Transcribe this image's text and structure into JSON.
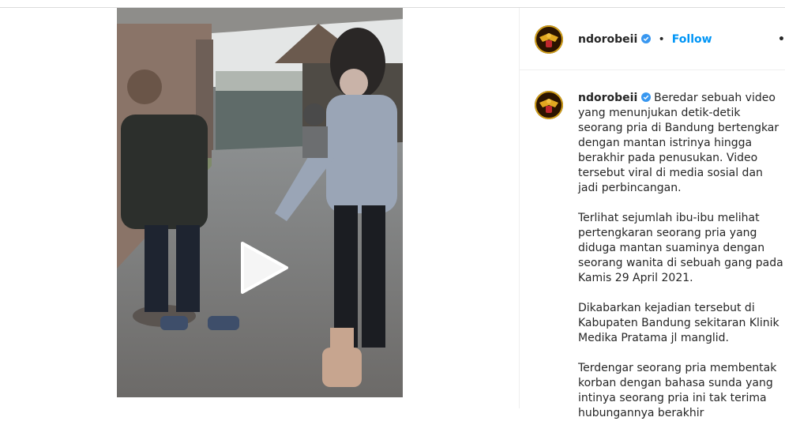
{
  "post": {
    "username": "ndorobeii",
    "follow_label": "Follow",
    "separator": "•",
    "more_glyph": "•"
  },
  "caption": {
    "username": "ndorobeii",
    "paragraphs": [
      "Beredar sebuah video yang menunjukan detik-detik seorang pria di Bandung bertengkar dengan mantan istrinya hingga berakhir pada penusukan. Video tersebut viral di media sosial dan jadi perbincangan.",
      "Terlihat sejumlah ibu-ibu melihat pertengkaran seorang pria yang diduga mantan suaminya dengan seorang wanita di sebuah gang pada Kamis 29 April 2021.",
      "Dikabarkan kejadian tersebut di Kabupaten Bandung sekitaran Klinik Medika Pratama jl manglid.",
      "Terdengar seorang pria membentak korban dengan bahasa sunda yang intinya seorang pria ini tak terima hubungannya berakhir"
    ]
  },
  "colors": {
    "accent": "#0095f6",
    "verified": "#3897f0",
    "text": "#262626"
  }
}
